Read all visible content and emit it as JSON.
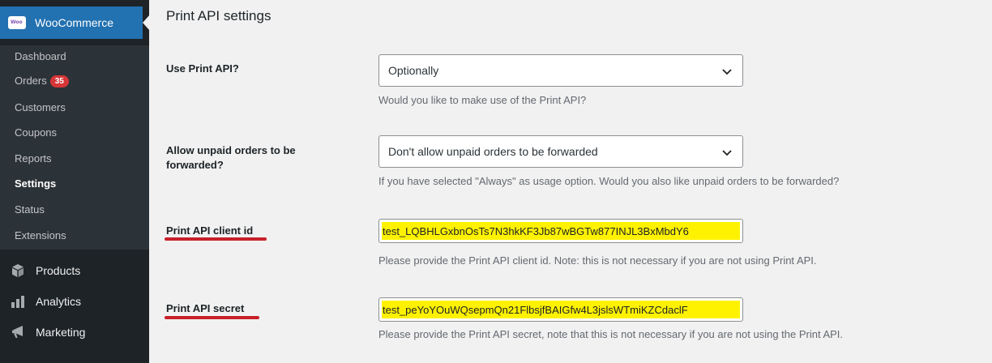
{
  "sidebar": {
    "active_menu": "WooCommerce",
    "submenu": [
      {
        "label": "Dashboard"
      },
      {
        "label": "Orders",
        "badge": "35"
      },
      {
        "label": "Customers"
      },
      {
        "label": "Coupons"
      },
      {
        "label": "Reports"
      },
      {
        "label": "Settings"
      },
      {
        "label": "Status"
      },
      {
        "label": "Extensions"
      }
    ],
    "menu": [
      {
        "label": "Products",
        "icon": "products-icon"
      },
      {
        "label": "Analytics",
        "icon": "analytics-icon"
      },
      {
        "label": "Marketing",
        "icon": "marketing-icon"
      }
    ]
  },
  "main": {
    "title": "Print API settings",
    "fields": [
      {
        "label": "Use Print API?",
        "value": "Optionally",
        "description": "Would you like to make use of the Print API?"
      },
      {
        "label": "Allow unpaid orders to be forwarded?",
        "value": "Don't allow unpaid orders to be forwarded",
        "description": "If you have selected \"Always\" as usage option. Would you also like unpaid orders to be forwarded?"
      },
      {
        "label": "Print API client id",
        "value": "test_LQBHLGxbnOsTs7N3hkKF3Jb87wBGTw877INJL3BxMbdY6",
        "description": "Please provide the Print API client id. Note: this is not necessary if you are not using Print API."
      },
      {
        "label": "Print API secret",
        "value": "test_peYoYOuWQsepmQn21FlbsjfBAIGfw4L3jslsWTmiKZCdaclF",
        "description": "Please provide the Print API secret, note that this is not necessary if you are not using the Print API."
      }
    ]
  },
  "colors": {
    "sidebar_bg": "#1e2327",
    "submenu_bg": "#2c3338",
    "active_bg": "#2271b1",
    "badge": "#d63638",
    "highlight": "#fff200",
    "annotation_underline": "#c8202a"
  }
}
